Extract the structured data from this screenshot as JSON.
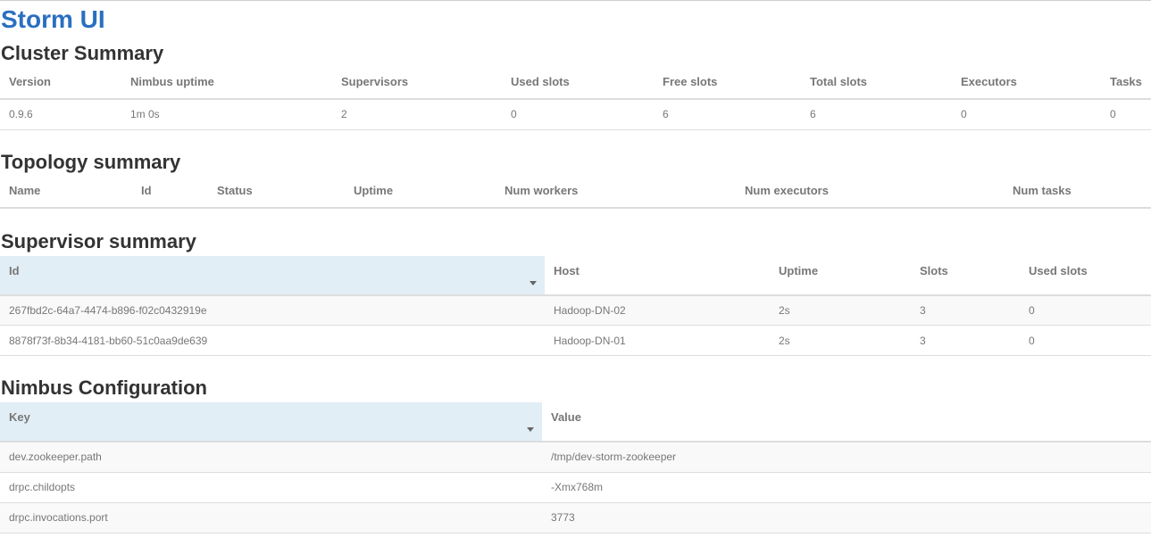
{
  "app": {
    "title": "Storm UI"
  },
  "cluster": {
    "heading": "Cluster Summary",
    "columns": [
      "Version",
      "Nimbus uptime",
      "Supervisors",
      "Used slots",
      "Free slots",
      "Total slots",
      "Executors",
      "Tasks"
    ],
    "values": [
      "0.9.6",
      "1m 0s",
      "2",
      "0",
      "6",
      "6",
      "0",
      "0"
    ]
  },
  "topology": {
    "heading": "Topology summary",
    "columns": [
      "Name",
      "Id",
      "Status",
      "Uptime",
      "Num workers",
      "Num executors",
      "Num tasks"
    ]
  },
  "supervisor": {
    "heading": "Supervisor summary",
    "columns": [
      "Id",
      "Host",
      "Uptime",
      "Slots",
      "Used slots"
    ],
    "rows": [
      [
        "267fbd2c-64a7-4474-b896-f02c0432919e",
        "Hadoop-DN-02",
        "2s",
        "3",
        "0"
      ],
      [
        "8878f73f-8b34-4181-bb60-51c0aa9de639",
        "Hadoop-DN-01",
        "2s",
        "3",
        "0"
      ]
    ]
  },
  "nimbus": {
    "heading": "Nimbus Configuration",
    "columns": [
      "Key",
      "Value"
    ],
    "rows": [
      [
        "dev.zookeeper.path",
        "/tmp/dev-storm-zookeeper"
      ],
      [
        "drpc.childopts",
        "-Xmx768m"
      ],
      [
        "drpc.invocations.port",
        "3773"
      ]
    ]
  },
  "icons": {
    "sort": "sort-descending-icon"
  }
}
